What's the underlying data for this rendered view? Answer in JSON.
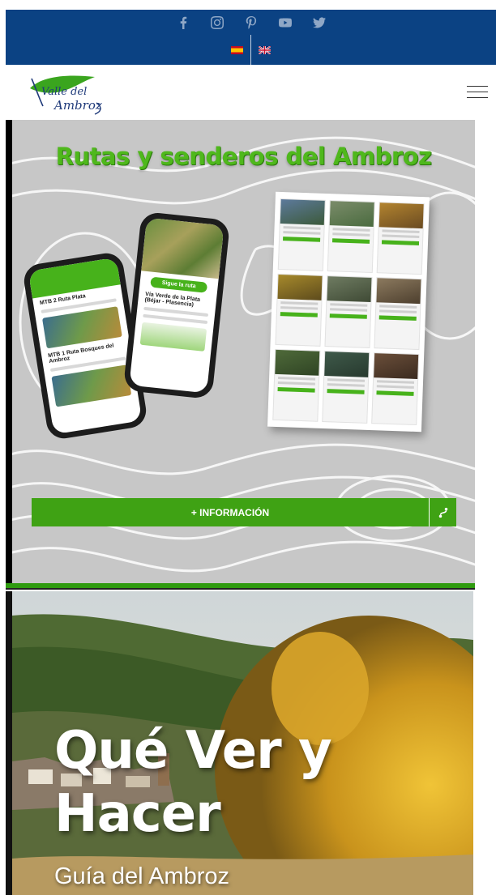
{
  "social": {
    "icons": [
      "facebook-icon",
      "instagram-icon",
      "pinterest-icon",
      "youtube-icon",
      "twitter-icon"
    ],
    "color": "#8fa7c6"
  },
  "languages": [
    "es-flag-icon",
    "uk-flag-icon"
  ],
  "header": {
    "logo_line1": "Valle del",
    "logo_line2": "Ambroz",
    "logo_colors": {
      "leaf": "#3aa51e",
      "text": "#1f3a7a"
    }
  },
  "routes_banner": {
    "title": "Rutas y senderos del Ambroz",
    "phone_button": "Sigue la ruta",
    "phone_route": "Vía Verde de la Plata (Béjar - Plasencia)",
    "phone_list_item1": "MTB 2 Ruta Plata",
    "phone_list_item2": "MTB 1 Ruta Bosques del Ambroz",
    "info_button": "+ INFORMACIÓN",
    "accent": "#3fa214"
  },
  "quever_banner": {
    "title_line1": "Qué Ver y",
    "title_line2": "Hacer",
    "subtitle": "Guía del Ambroz"
  },
  "colors": {
    "topbar": "#0b4283",
    "green": "#47b21b",
    "banner_bg": "#c7c7c7"
  }
}
